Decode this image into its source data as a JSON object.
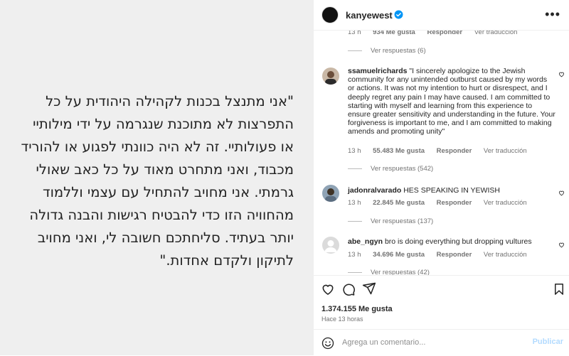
{
  "post": {
    "text": "\"אני מתנצל בכנות לקהילה היהודית על כל התפרצות לא מתוכנת שנגרמה על ידי מילותיי או פעולותיי. זה לא היה כוונתי לפגוע או להוריד מכבוד, ואני מתחרט מאוד על כל כאב שאולי גרמתי. אני מחויב להתחיל עם עצמי וללמוד מהחוויה הזו כדי להבטיח רגישות והבנה גדולה יותר בעתיד. סליחתכם חשובה לי, ואני מחויב לתיקון ולקדם אחדות.\""
  },
  "header": {
    "username": "kanyewest",
    "more_label": "•••"
  },
  "top_meta": {
    "time": "13 h",
    "likes": "934 Me gusta",
    "reply": "Responder",
    "translate": "Ver traducción"
  },
  "top_replies": "Ver respuestas (6)",
  "comments": [
    {
      "user": "ssamuelrichards",
      "text": "\"I sincerely apologize to the Jewish community for any unintended outburst caused by my words or actions. It was not my intention to hurt or disrespect, and I deeply regret any pain I may have caused. I am committed to starting with myself and learning from this experience to ensure greater sensitivity and understanding in the future. Your forgiveness is important to me, and I am committed to making amends and promoting unity\"",
      "time": "13 h",
      "likes": "55.483 Me gusta",
      "reply": "Responder",
      "translate": "Ver traducción",
      "replies": "Ver respuestas (542)"
    },
    {
      "user": "jadonralvarado",
      "text": "HES SPEAKING IN YEWISH",
      "time": "13 h",
      "likes": "22.845 Me gusta",
      "reply": "Responder",
      "translate": "Ver traducción",
      "replies": "Ver respuestas (137)"
    },
    {
      "user": "abe_ngyn",
      "text": "bro is doing everything but dropping vultures",
      "time": "13 h",
      "likes": "34.696 Me gusta",
      "reply": "Responder",
      "translate": "Ver traducción",
      "replies": "Ver respuestas (42)"
    }
  ],
  "footer": {
    "likes": "1.374.155 Me gusta",
    "time": "Hace 13 horas",
    "comment_placeholder": "Agrega un comentario...",
    "post_label": "Publicar"
  },
  "colors": {
    "verified": "#0095f6",
    "muted_text": "#737373",
    "post_button": "#b3dbff",
    "left_panel": "#efefef"
  }
}
